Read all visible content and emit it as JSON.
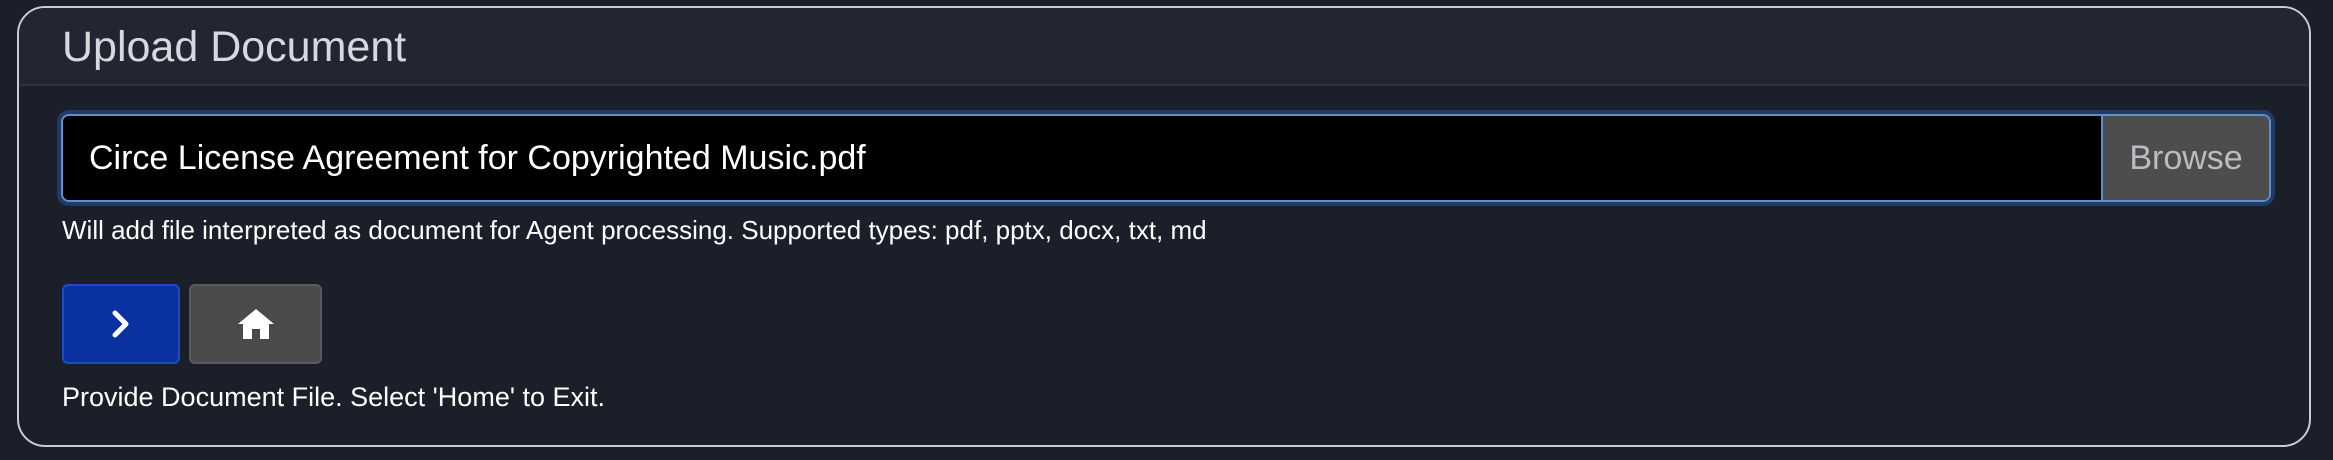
{
  "header": {
    "title": "Upload Document"
  },
  "file_picker": {
    "value": "Circe License Agreement for Copyrighted Music.pdf",
    "browse_label": "Browse",
    "help_text": "Will add file interpreted as document for Agent processing. Supported types: pdf, pptx, docx, txt, md"
  },
  "actions": {
    "next_icon": "chevron-right-icon",
    "home_icon": "home-icon",
    "next_color": "#0a31a0",
    "home_color": "#4a4a4a"
  },
  "status": {
    "message": "Provide Document File. Select 'Home' to Exit."
  }
}
